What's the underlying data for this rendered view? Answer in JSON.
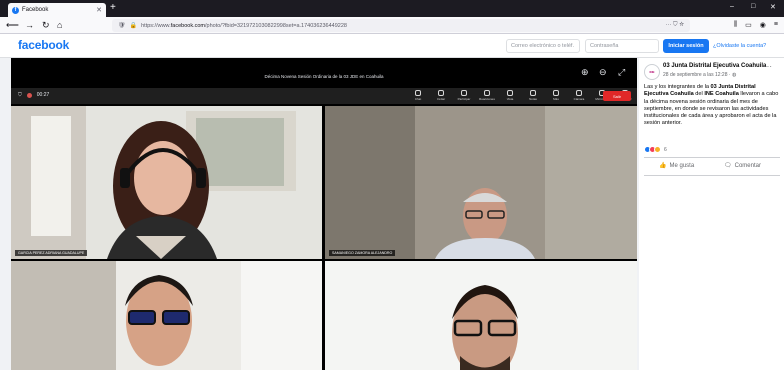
{
  "browser": {
    "tab_title": "Facebook",
    "url_prefix": "https://www.",
    "url_host": "facebook.com",
    "url_path": "/photo/?fbid=3219721030822998set=a.174036236449228",
    "window_controls": [
      "–",
      "□",
      "✕"
    ]
  },
  "header": {
    "logo": "facebook",
    "email_placeholder": "Correo electrónico o teléf.",
    "password_placeholder": "Contraseña",
    "login_label": "Iniciar sesión",
    "forgot_label": "¿Olvidaste la cuenta?"
  },
  "viewer": {
    "meeting_title": "Décima Novena Sesión Ordinaria de la 03 JDE en Coahuila",
    "recording_time": "00:27",
    "controls": [
      "Chat",
      "Invitar",
      "Participar",
      "Reacciones",
      "Vista",
      "Notas",
      "Más",
      "Cámara",
      "Micrófono",
      "Compartir"
    ],
    "leave_label": "Salir",
    "tiles": [
      {
        "label": "GARCIA PEREZ ADRIANA GUADALUPE"
      },
      {
        "label": "SAMANIEGO ZAMORA ALEJANDRO"
      },
      {
        "label": ""
      },
      {
        "label": ""
      }
    ]
  },
  "post": {
    "avatar_text": "INE",
    "page_name": "03 Junta Distrital Ejecutiva Coahuila",
    "date": "28 de septiembre a las 12:28 · ",
    "text_1": "Las y los integrantes de la ",
    "text_bold_1": "03 Junta Distrital Ejecutiva Coahuila",
    "text_2": " del ",
    "text_bold_2": "INE Coahuila",
    "text_3": " llevaron a cabo la décima novena sesión ordinaria del mes de septiembre, en donde se revisaron las actividades institucionales de cada área y aprobaron el acta de la sesión anterior.",
    "reaction_count": "6",
    "like_label": "Me gusta",
    "comment_label": "Comentar"
  },
  "colors": {
    "brand": "#1877f2",
    "leave": "#e02828"
  }
}
